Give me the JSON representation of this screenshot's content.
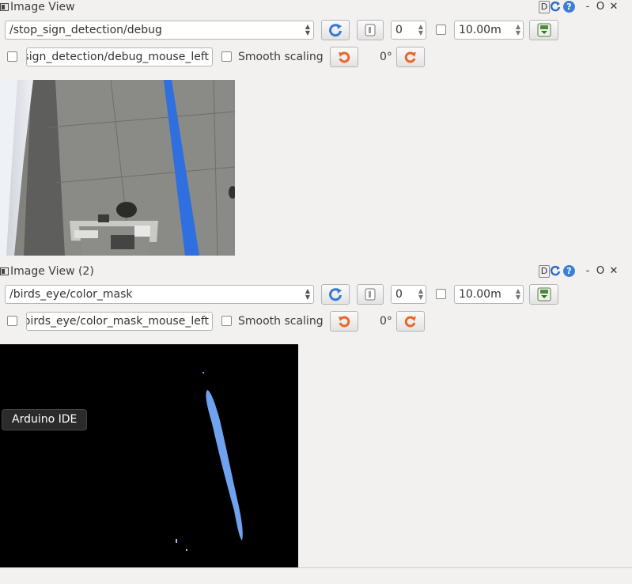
{
  "panels": [
    {
      "title": "Image View",
      "topic": "/stop_sign_detection/debug",
      "spin_value": "0",
      "duration": "10.00m",
      "mouse_topic": "sign_detection/debug_mouse_left",
      "smooth_scaling_label": "Smooth scaling",
      "rotation": "0°"
    },
    {
      "title": "Image View (2)",
      "topic": "/birds_eye/color_mask",
      "spin_value": "0",
      "duration": "10.00m",
      "mouse_topic": "birds_eye/color_mask_mouse_left",
      "smooth_scaling_label": "Smooth scaling",
      "rotation": "0°"
    }
  ],
  "titlebar_buttons": {
    "d": "D",
    "help": "?",
    "minimize": "-",
    "float": "O",
    "close": "✕"
  },
  "tooltip": "Arduino IDE",
  "colors": {
    "mask_blue": "#6fa3f0",
    "lane_blue": "#2f6fe0",
    "reload_blue": "#3579d6",
    "rotate_orange": "#e8672a"
  }
}
